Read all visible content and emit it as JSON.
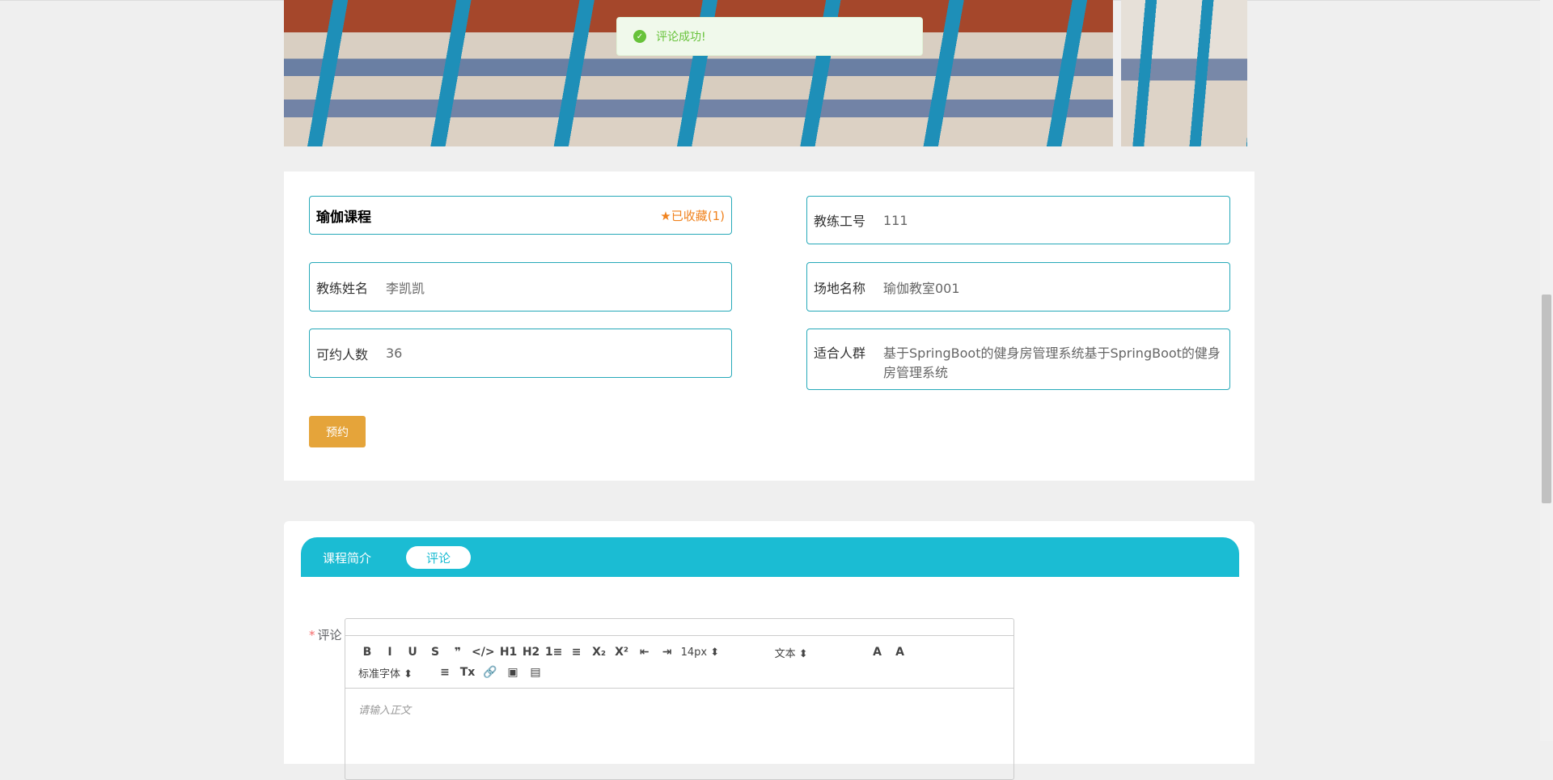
{
  "toast": {
    "message": "评论成功!",
    "icon": "check-circle-icon",
    "color": "#67c23a"
  },
  "course": {
    "title": "瑜伽课程",
    "favorite": "已收藏(1)",
    "favorite_icon": "star-icon",
    "fields": [
      {
        "label": "教练工号",
        "value": "111"
      },
      {
        "label": "教练姓名",
        "value": "李凯凯"
      },
      {
        "label": "场地名称",
        "value": "瑜伽教室001"
      },
      {
        "label": "可约人数",
        "value": "36"
      },
      {
        "label": "适合人群",
        "value": "基于SpringBoot的健身房管理系统基于SpringBoot的健身房管理系统"
      }
    ],
    "book_button": "预约"
  },
  "tabs": [
    {
      "label": "课程简介",
      "active": false
    },
    {
      "label": "评论",
      "active": true
    }
  ],
  "comment": {
    "required_mark": "*",
    "label": "评论",
    "placeholder": "请输入正文",
    "toolbar_row1": [
      "B",
      "I",
      "U",
      "S",
      "❞",
      "</>",
      "H1",
      "H2",
      "1≡",
      "≡",
      "X₂",
      "X²",
      "⇤",
      "⇥",
      "14px ⬍",
      "文本 ⬍",
      "A",
      "A"
    ],
    "toolbar_row2": [
      "标准字体 ⬍",
      "≡",
      "Tx",
      "🔗",
      "▣",
      "▤"
    ],
    "toolbar_row1_names": [
      "bold",
      "italic",
      "underline",
      "strike",
      "blockquote",
      "code-block",
      "header-1",
      "header-2",
      "ordered-list",
      "bullet-list",
      "subscript",
      "superscript",
      "outdent",
      "indent",
      "size",
      "header",
      "color",
      "background"
    ],
    "toolbar_row2_names": [
      "font",
      "align",
      "clean",
      "link",
      "image",
      "video"
    ]
  },
  "colors": {
    "accent": "#1bbcd3",
    "border": "#26a9b9",
    "button": "#e5a43a",
    "favorite": "#f0831f"
  }
}
